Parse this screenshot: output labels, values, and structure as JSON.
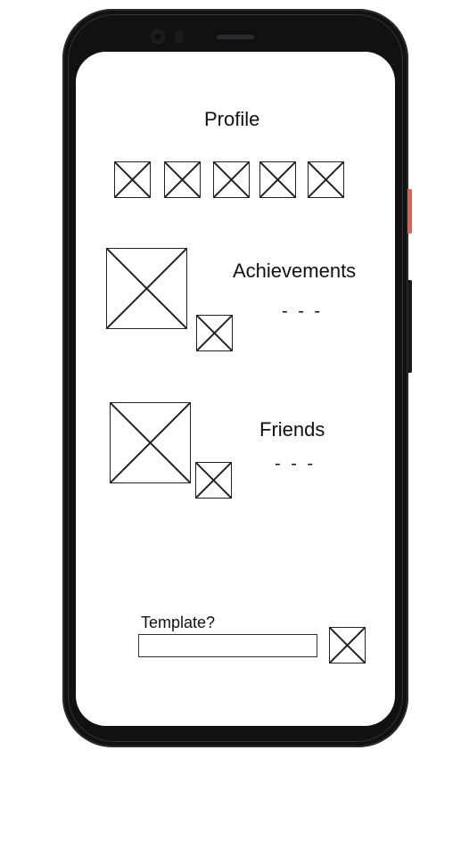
{
  "profile": {
    "title": "Profile",
    "badges": [
      {
        "icon": "image-placeholder-icon"
      },
      {
        "icon": "image-placeholder-icon"
      },
      {
        "icon": "image-placeholder-icon"
      },
      {
        "icon": "image-placeholder-icon"
      },
      {
        "icon": "image-placeholder-icon"
      }
    ]
  },
  "achievements": {
    "title": "Achievements",
    "value": "- - -"
  },
  "friends": {
    "title": "Friends",
    "value": "- - -"
  },
  "template": {
    "label": "Template?",
    "input_value": "",
    "input_placeholder": ""
  },
  "colors": {
    "frame": "#111113",
    "side_accent": "#d9634f",
    "screen": "#ffffff",
    "wireframe_stroke": "#222222"
  }
}
